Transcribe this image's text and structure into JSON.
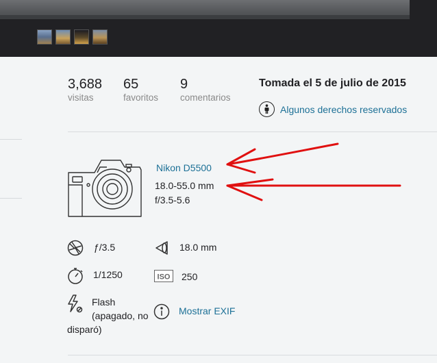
{
  "stats": [
    {
      "value": "3,688",
      "label": "visitas"
    },
    {
      "value": "65",
      "label": "favoritos"
    },
    {
      "value": "9",
      "label": "comentarios"
    }
  ],
  "taken_date": "Tomada el 5 de julio de 2015",
  "license": {
    "icon": "license-icon",
    "text": "Algunos derechos reservados"
  },
  "camera": {
    "icon": "camera-icon",
    "model": "Nikon D5500",
    "lens": "18.0-55.0 mm",
    "aperture_range": "f/3.5-5.6"
  },
  "exif": {
    "aperture": {
      "icon": "aperture-icon",
      "value": "ƒ/3.5"
    },
    "focal_length": {
      "icon": "focal-length-icon",
      "value": "18.0 mm"
    },
    "shutter": {
      "icon": "timer-icon",
      "value": "1/1250"
    },
    "iso": {
      "icon": "iso-icon",
      "value": "250"
    },
    "flash": {
      "icon": "flash-icon",
      "line1": "Flash",
      "line2": "(apagado, no",
      "line3": "disparó)"
    },
    "show_exif": {
      "icon": "info-icon",
      "label": "Mostrar EXIF"
    }
  },
  "colors": {
    "link": "#1c7096",
    "text": "#212124",
    "muted": "#898989",
    "background": "#f3f5f6",
    "dark_header": "#212124",
    "annotation": "#e01010"
  }
}
